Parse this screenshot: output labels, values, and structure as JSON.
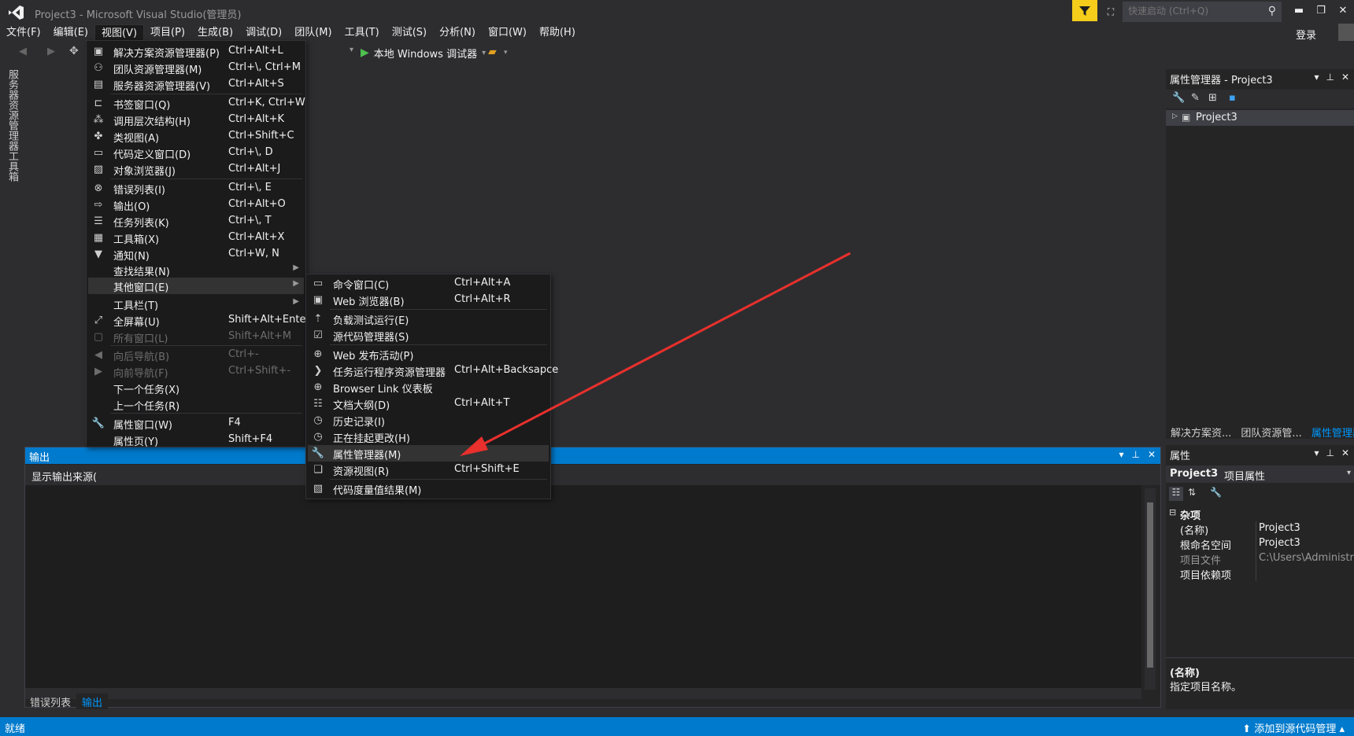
{
  "window": {
    "title": "Project3 - Microsoft Visual Studio(管理员)",
    "quick_launch_placeholder": "快速启动 (Ctrl+Q)",
    "login": "登录",
    "min": "▬",
    "max": "❐",
    "close": "✕"
  },
  "menubar": [
    "文件(F)",
    "编辑(E)",
    "视图(V)",
    "项目(P)",
    "生成(B)",
    "调试(D)",
    "团队(M)",
    "工具(T)",
    "测试(S)",
    "分析(N)",
    "窗口(W)",
    "帮助(H)"
  ],
  "toolbar": {
    "debug_target": "本地 Windows 调试器"
  },
  "left_tabs": [
    "服务器资源管理器",
    "工具箱"
  ],
  "view_menu": [
    {
      "label": "解决方案资源管理器(P)",
      "shortcut": "Ctrl+Alt+L",
      "icon": "solution-explorer-icon",
      "glyph": "▣"
    },
    {
      "label": "团队资源管理器(M)",
      "shortcut": "Ctrl+\\, Ctrl+M",
      "icon": "team-explorer-icon",
      "glyph": "⚇"
    },
    {
      "label": "服务器资源管理器(V)",
      "shortcut": "Ctrl+Alt+S",
      "icon": "server-explorer-icon",
      "glyph": "▤"
    },
    {
      "label": "书签窗口(Q)",
      "shortcut": "Ctrl+K, Ctrl+W",
      "icon": "bookmark-icon",
      "glyph": "⊏"
    },
    {
      "label": "调用层次结构(H)",
      "shortcut": "Ctrl+Alt+K",
      "icon": "call-hierarchy-icon",
      "glyph": "⁂"
    },
    {
      "label": "类视图(A)",
      "shortcut": "Ctrl+Shift+C",
      "icon": "class-view-icon",
      "glyph": "✤"
    },
    {
      "label": "代码定义窗口(D)",
      "shortcut": "Ctrl+\\, D",
      "icon": "code-definition-icon",
      "glyph": "▭"
    },
    {
      "label": "对象浏览器(J)",
      "shortcut": "Ctrl+Alt+J",
      "icon": "object-browser-icon",
      "glyph": "▨"
    },
    {
      "label": "错误列表(I)",
      "shortcut": "Ctrl+\\, E",
      "icon": "error-list-icon",
      "glyph": "⊗"
    },
    {
      "label": "输出(O)",
      "shortcut": "Ctrl+Alt+O",
      "icon": "output-icon",
      "glyph": "⇨"
    },
    {
      "label": "任务列表(K)",
      "shortcut": "Ctrl+\\, T",
      "icon": "task-list-icon",
      "glyph": "☰"
    },
    {
      "label": "工具箱(X)",
      "shortcut": "Ctrl+Alt+X",
      "icon": "toolbox-icon",
      "glyph": "▦"
    },
    {
      "label": "通知(N)",
      "shortcut": "Ctrl+W, N",
      "icon": "notification-icon",
      "glyph": "▼"
    },
    {
      "label": "查找结果(N)",
      "shortcut": "",
      "icon": "",
      "glyph": "",
      "submenu": true
    },
    {
      "label": "其他窗口(E)",
      "shortcut": "",
      "icon": "",
      "glyph": "",
      "submenu": true
    },
    {
      "label": "工具栏(T)",
      "shortcut": "",
      "icon": "",
      "glyph": "",
      "submenu": true
    },
    {
      "label": "全屏幕(U)",
      "shortcut": "Shift+Alt+Enter",
      "icon": "fullscreen-icon",
      "glyph": "⤢"
    },
    {
      "label": "所有窗口(L)",
      "shortcut": "Shift+Alt+M",
      "icon": "all-windows-icon",
      "glyph": "▢"
    },
    {
      "label": "向后导航(B)",
      "shortcut": "Ctrl+-",
      "icon": "navigate-back-icon",
      "glyph": "◀"
    },
    {
      "label": "向前导航(F)",
      "shortcut": "Ctrl+Shift+-",
      "icon": "navigate-forward-icon",
      "glyph": "▶"
    },
    {
      "label": "下一个任务(X)",
      "shortcut": "",
      "icon": "",
      "glyph": ""
    },
    {
      "label": "上一个任务(R)",
      "shortcut": "",
      "icon": "",
      "glyph": ""
    },
    {
      "label": "属性窗口(W)",
      "shortcut": "F4",
      "icon": "properties-window-icon",
      "glyph": "🔧"
    },
    {
      "label": "属性页(Y)",
      "shortcut": "Shift+F4",
      "icon": "",
      "glyph": ""
    }
  ],
  "other_windows_menu": [
    {
      "label": "命令窗口(C)",
      "shortcut": "Ctrl+Alt+A",
      "icon": "command-window-icon",
      "glyph": "▭"
    },
    {
      "label": "Web 浏览器(B)",
      "shortcut": "Ctrl+Alt+R",
      "icon": "web-browser-icon",
      "glyph": "▣"
    },
    {
      "label": "负载测试运行(E)",
      "shortcut": "",
      "icon": "load-test-icon",
      "glyph": "⇡"
    },
    {
      "label": "源代码管理器(S)",
      "shortcut": "",
      "icon": "source-control-icon",
      "glyph": "☑"
    },
    {
      "label": "Web 发布活动(P)",
      "shortcut": "",
      "icon": "web-publish-icon",
      "glyph": "⊕"
    },
    {
      "label": "任务运行程序资源管理器",
      "shortcut": "Ctrl+Alt+Backsapce",
      "icon": "task-runner-icon",
      "glyph": "❯"
    },
    {
      "label": "Browser Link 仪表板",
      "shortcut": "",
      "icon": "browser-link-icon",
      "glyph": "⊕"
    },
    {
      "label": "文档大纲(D)",
      "shortcut": "Ctrl+Alt+T",
      "icon": "document-outline-icon",
      "glyph": "☷"
    },
    {
      "label": "历史记录(I)",
      "shortcut": "",
      "icon": "history-icon",
      "glyph": "◷"
    },
    {
      "label": "正在挂起更改(H)",
      "shortcut": "",
      "icon": "pending-changes-icon",
      "glyph": "◷"
    },
    {
      "label": "属性管理器(M)",
      "shortcut": "",
      "icon": "property-manager-icon",
      "glyph": "🔧"
    },
    {
      "label": "资源视图(R)",
      "shortcut": "Ctrl+Shift+E",
      "icon": "resource-view-icon",
      "glyph": "❏"
    },
    {
      "label": "代码度量值结果(M)",
      "shortcut": "",
      "icon": "code-metrics-icon",
      "glyph": "▧"
    }
  ],
  "output_panel": {
    "title": "输出",
    "source_label": "显示输出来源(",
    "tabs": [
      "错误列表",
      "输出"
    ]
  },
  "property_manager": {
    "title": "属性管理器 - Project3",
    "tree_item": "Project3",
    "tabs": [
      "解决方案资...",
      "团队资源管...",
      "属性管理器"
    ]
  },
  "properties": {
    "title": "属性",
    "object": "Project3",
    "object_type": "项目属性",
    "category": "杂项",
    "rows": [
      {
        "key": "(名称)",
        "value": "Project3",
        "dim": false
      },
      {
        "key": "根命名空间",
        "value": "Project3",
        "dim": false
      },
      {
        "key": "项目文件",
        "value": "C:\\Users\\Administrat",
        "dim": true
      },
      {
        "key": "项目依赖项",
        "value": "",
        "dim": false
      }
    ],
    "desc_title": "(名称)",
    "desc_text": "指定项目名称。"
  },
  "status": {
    "text": "就绪",
    "source_control": "添加到源代码管理"
  },
  "colors": {
    "accent": "#007acc",
    "arrow": "#e8302c",
    "filter": "#f5cd1a"
  }
}
